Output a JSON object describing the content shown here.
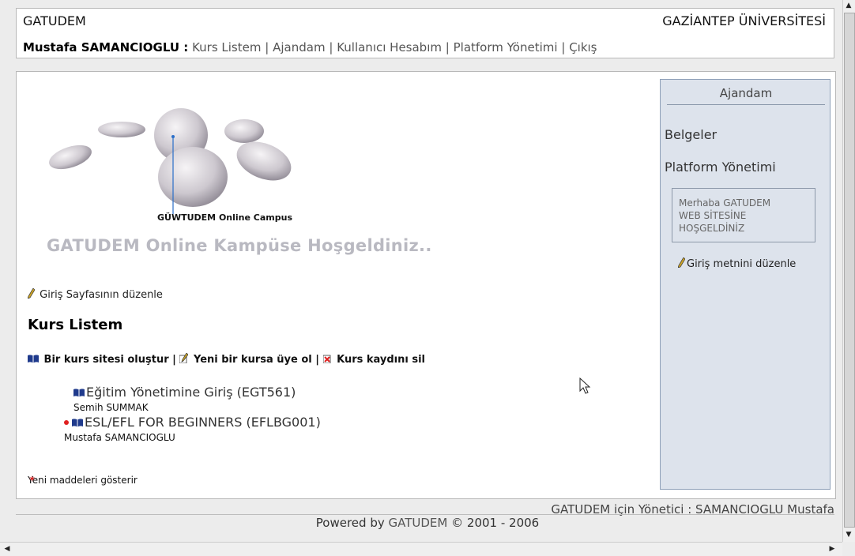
{
  "header": {
    "site_name": "GATUDEM",
    "university": "GAZİANTEP ÜNİVERSİTESİ",
    "user": "Mustafa SAMANCIOGLU :",
    "nav": [
      "Kurs Listem",
      "Ajandam",
      "Kullanıcı Hesabım",
      "Platform Yönetimi",
      "Çıkış"
    ],
    "separator": "|"
  },
  "main": {
    "campus_caption": "GÜWTUDEM Online Campus",
    "welcome_heading": "GATUDEM Online Kampüse Hoşgeldiniz..",
    "edit_home_link": "Giriş Sayfasının düzenle",
    "courses_heading": "Kurs Listem",
    "course_actions": {
      "create": "Bir kurs sitesi oluştur",
      "enroll": "Yeni bir kursa üye ol",
      "unenroll": "Kurs kaydını sil",
      "separator": "|"
    },
    "courses": [
      {
        "title": "Eğitim Yönetimine Giriş (EGT561)",
        "teacher": "Semih SUMMAK",
        "new": false
      },
      {
        "title": "ESL/EFL FOR BEGINNERS (EFLBG001)",
        "teacher": "Mustafa SAMANCIOGLU",
        "new": true
      }
    ],
    "show_new_items": "Yeni maddeleri gösterir"
  },
  "sidebar": {
    "title": "Ajandam",
    "links": [
      "Belgeler",
      "Platform Yönetimi"
    ],
    "welcome_box": [
      "Merhaba GATUDEM",
      "WEB SİTESİNE",
      "HOŞGELDİNİZ"
    ],
    "edit_intro_link": "Giriş metnini düzenle"
  },
  "footer": {
    "admin": "GATUDEM için Yönetici : SAMANCIOGLU Mustafa",
    "powered_prefix": "Powered by",
    "powered_brand": "GATUDEM",
    "copyright": "© 2001 - 2006"
  },
  "colors": {
    "page_bg": "#ececec",
    "sidebar_bg": "#dde3ec",
    "welcome_heading": "#b9b9c1",
    "book_icon": "#1f3a8c",
    "new_dot": "#e02020"
  }
}
